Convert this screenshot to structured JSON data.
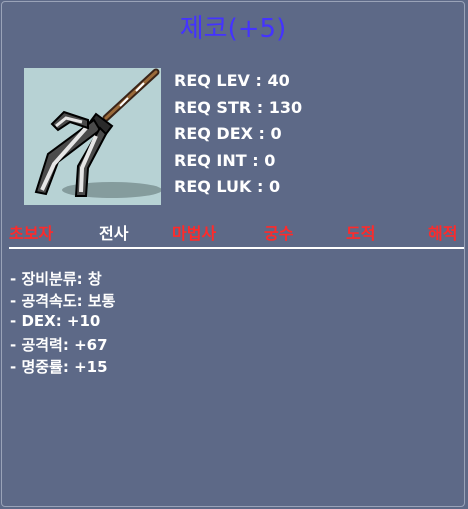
{
  "item": {
    "name": "제코(+5)"
  },
  "requirements": [
    "REQ LEV : 40",
    "REQ STR : 130",
    "REQ DEX : 0",
    "REQ INT : 0",
    "REQ LUK : 0"
  ],
  "jobs": [
    {
      "label": "초보자",
      "color": "red"
    },
    {
      "label": "전사",
      "color": "white"
    },
    {
      "label": "마법사",
      "color": "red"
    },
    {
      "label": "궁수",
      "color": "red"
    },
    {
      "label": "도적",
      "color": "red"
    },
    {
      "label": "해적",
      "color": "red"
    }
  ],
  "stats": [
    "- 장비분류: 창",
    "- 공격속도: 보통",
    "- DEX: +10",
    "- 공격력: +67",
    "- 명중률: +15"
  ],
  "colors": {
    "background": "#5d6987",
    "title": "#4433ff",
    "icon_bg": "#b7d2d4",
    "restricted_job": "#ff2a2a",
    "allowed_job": "#ffffff"
  },
  "icon": "polearm-weapon-icon"
}
